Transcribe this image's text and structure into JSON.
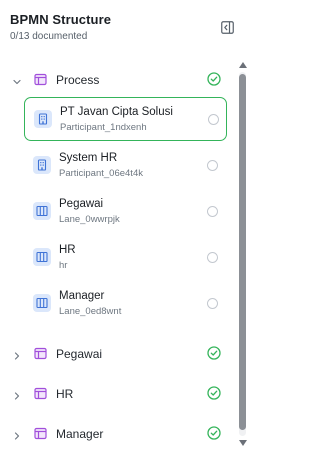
{
  "header": {
    "title": "BPMN Structure",
    "progress": "0/13 documented",
    "collapse_icon": "panel-collapse-icon"
  },
  "colors": {
    "accent_green": "#34b45a",
    "group_icon_purple": "#a14fdb",
    "item_icon_blue": "#3f73d6",
    "item_icon_bg": "#dbe7fb"
  },
  "tree": {
    "groups": [
      {
        "label": "Process",
        "expanded": true,
        "icon": "process-icon",
        "status": "complete",
        "children": [
          {
            "name": "PT Javan Cipta Solusi",
            "id": "Participant_1ndxenh",
            "icon": "building-icon",
            "selected": true
          },
          {
            "name": "System HR",
            "id": "Participant_06e4t4k",
            "icon": "building-icon",
            "selected": false
          },
          {
            "name": "Pegawai",
            "id": "Lane_0wwrpjk",
            "icon": "lane-icon",
            "selected": false
          },
          {
            "name": "HR",
            "id": "hr",
            "icon": "lane-icon",
            "selected": false
          },
          {
            "name": "Manager",
            "id": "Lane_0ed8wnt",
            "icon": "lane-icon",
            "selected": false
          }
        ]
      },
      {
        "label": "Pegawai",
        "expanded": false,
        "icon": "process-icon",
        "status": "complete"
      },
      {
        "label": "HR",
        "expanded": false,
        "icon": "process-icon",
        "status": "complete"
      },
      {
        "label": "Manager",
        "expanded": false,
        "icon": "process-icon",
        "status": "complete"
      }
    ]
  }
}
